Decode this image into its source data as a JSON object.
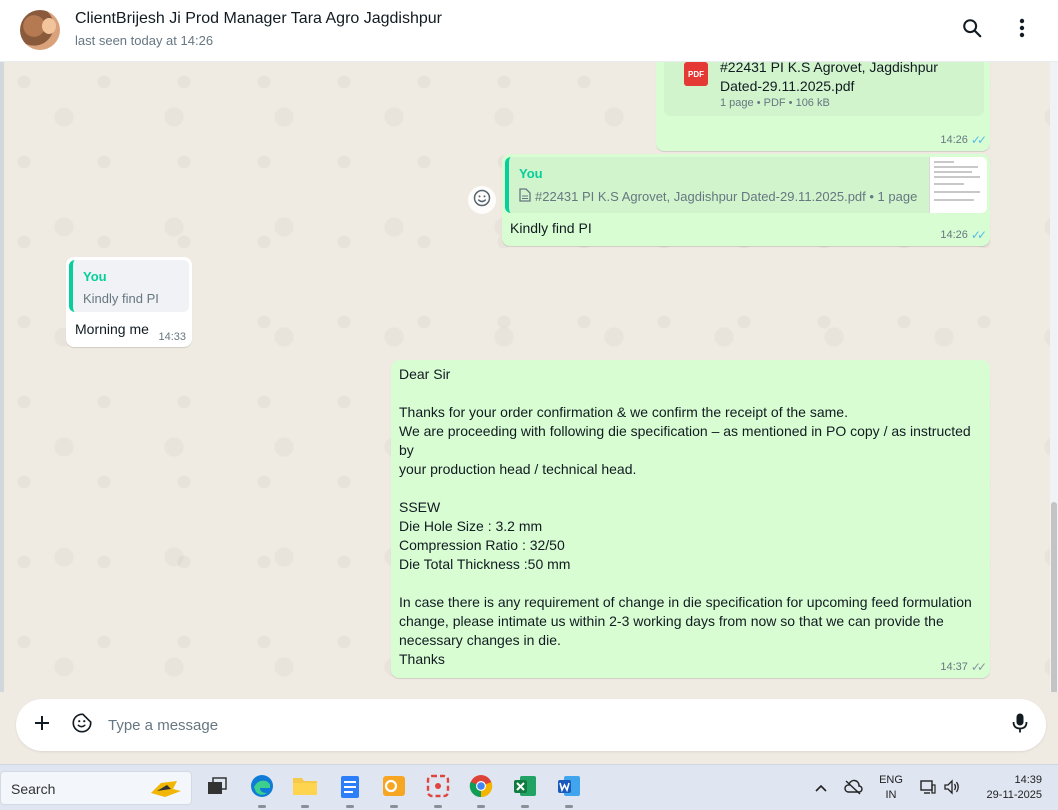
{
  "header": {
    "contact_name": "ClientBrijesh Ji Prod Manager Tara Agro Jagdishpur",
    "status": "last seen today at 14:26"
  },
  "messages": {
    "pdf_message": {
      "file_name_line1": "#22431 PI K.S Agrovet, Jagdishpur",
      "file_name_line2": "Dated-29.11.2025.pdf",
      "icon_label": "PDF",
      "meta": "1 page • PDF • 106 kB",
      "time": "14:26"
    },
    "reply_pi": {
      "quote_author": "You",
      "quote_text": "#22431 PI K.S Agrovet, Jagdishpur Dated-29.11.2025.pdf • 1 page",
      "text": "Kindly find PI",
      "time": "14:26"
    },
    "incoming": {
      "quote_author": "You",
      "quote_text": "Kindly find PI",
      "text": "Morning me",
      "time": "14:33"
    },
    "long_message": {
      "lines": [
        "Dear Sir",
        "",
        "Thanks for your order confirmation & we confirm the receipt of the same.",
        "We are proceeding with following die specification – as mentioned in PO copy / as instructed",
        "by",
        "your production head / technical head.",
        "",
        "SSEW",
        "Die Hole Size : 3.2 mm",
        "Compression Ratio : 32/50",
        "Die Total Thickness :50 mm",
        "",
        "In case there is any requirement of change in die specification for upcoming feed formulation",
        "change, please intimate us within 2-3 working days from now so that we can provide the",
        "necessary changes in die.",
        "Thanks"
      ],
      "time": "14:37"
    }
  },
  "composer": {
    "placeholder": "Type a message"
  },
  "taskbar": {
    "search_label": "Search",
    "lang_line1": "ENG",
    "lang_line2": "IN",
    "time": "14:39",
    "date": "29-11-2025"
  },
  "colors": {
    "outgoing_bubble": "#d9fdd3",
    "incoming_bubble": "#ffffff",
    "read_ticks": "#53bdeb",
    "quote_accent": "#06cf9c",
    "chat_background": "#efeae2"
  },
  "icons": [
    "search-icon",
    "menu-icon",
    "file-icon",
    "emoji-react-icon",
    "plus-icon",
    "sticker-icon",
    "microphone-icon"
  ]
}
